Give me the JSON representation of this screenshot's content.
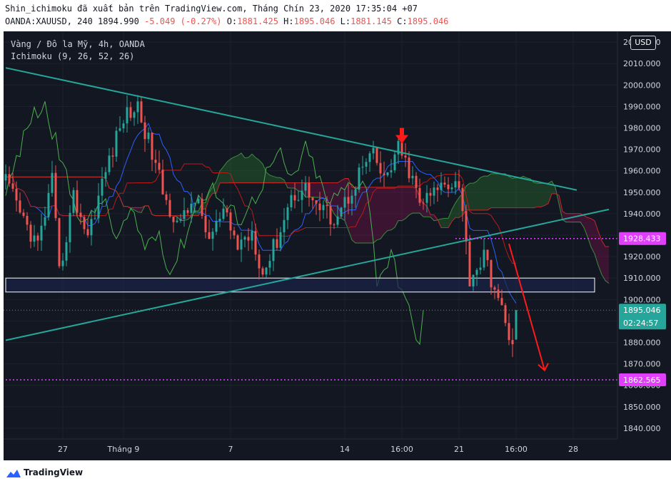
{
  "header": {
    "publish_line": "Shin_ichimoku đã xuất bản trên TradingView.com, Tháng Chín 23, 2020 17:35:04 +07",
    "symbol_prefix": "OANDA:XAUUSD, 240 1894.990",
    "change": "-5.049 (-0.27%)",
    "o_label": "O:",
    "o_value": "1881.425",
    "h_label": "H:",
    "h_value": "1895.046",
    "l_label": "L:",
    "l_value": "1881.145",
    "c_label": "C:",
    "c_value": "1895.046"
  },
  "legend": {
    "instrument": "Vàng / Đô la Mỹ, 4h, OANDA",
    "indicator": "Ichimoku (9, 26, 52, 26)"
  },
  "currency": "USD",
  "footer": {
    "brand": "TradingView"
  },
  "colors": {
    "background": "#131722",
    "up": "#26a69a",
    "down": "#ef5350",
    "trendline": "#26a69a",
    "level": "#e040fb",
    "tenkan": "#2962ff",
    "kijun": "#b71c1c",
    "chikou": "#4caf50",
    "cloud_bull": "#2e7d32",
    "cloud_bear": "#880e4f",
    "grid": "#1e222d",
    "axis_text": "#d1d4dc",
    "arrow": "#ff1a1a"
  },
  "chart_data": {
    "type": "candlestick",
    "symbol": "OANDA:XAUUSD",
    "timeframe": "4h",
    "ylim": [
      1835,
      2025
    ],
    "y_ticks": [
      1840,
      1850,
      1860,
      1870,
      1880,
      1890,
      1900,
      1910,
      1920,
      1930,
      1940,
      1950,
      1960,
      1970,
      1980,
      1990,
      2000,
      2010,
      2020
    ],
    "y_tick_labels": [
      "1840.000",
      "1850.000",
      "1860.000",
      "1870.000",
      "1880.000",
      "1890.000",
      "1900.000",
      "1910.000",
      "1920.000",
      "1930.000",
      "1940.000",
      "1950.000",
      "1960.000",
      "1970.000",
      "1980.000",
      "1990.000",
      "2000.000",
      "2010.000",
      "2020.000"
    ],
    "x_bars": 170,
    "x_ticks": [
      {
        "bar": 16,
        "label": "27"
      },
      {
        "bar": 33,
        "label": "Tháng 9"
      },
      {
        "bar": 63,
        "label": "7"
      },
      {
        "bar": 95,
        "label": "14"
      },
      {
        "bar": 111,
        "label": "16:00"
      },
      {
        "bar": 127,
        "label": "21"
      },
      {
        "bar": 143,
        "label": "16:00"
      },
      {
        "bar": 159,
        "label": "28"
      }
    ],
    "anchors": [
      [
        0,
        1955
      ],
      [
        4,
        1940
      ],
      [
        9,
        1925
      ],
      [
        13,
        1955
      ],
      [
        15,
        1912
      ],
      [
        19,
        1948
      ],
      [
        23,
        1930
      ],
      [
        28,
        1960
      ],
      [
        33,
        1985
      ],
      [
        37,
        1990
      ],
      [
        41,
        1968
      ],
      [
        45,
        1945
      ],
      [
        49,
        1935
      ],
      [
        53,
        1948
      ],
      [
        57,
        1928
      ],
      [
        61,
        1940
      ],
      [
        65,
        1925
      ],
      [
        69,
        1932
      ],
      [
        72,
        1912
      ],
      [
        76,
        1928
      ],
      [
        80,
        1948
      ],
      [
        84,
        1952
      ],
      [
        88,
        1942
      ],
      [
        92,
        1938
      ],
      [
        96,
        1948
      ],
      [
        100,
        1962
      ],
      [
        103,
        1967
      ],
      [
        106,
        1955
      ],
      [
        110,
        1970
      ],
      [
        113,
        1960
      ],
      [
        116,
        1945
      ],
      [
        119,
        1948
      ],
      [
        123,
        1955
      ],
      [
        127,
        1955
      ],
      [
        130,
        1910
      ],
      [
        134,
        1920
      ],
      [
        137,
        1905
      ],
      [
        140,
        1888
      ],
      [
        142,
        1881
      ],
      [
        143,
        1895
      ]
    ],
    "seed": 42,
    "last_price": 1895.046,
    "last_price_label": "1895.046",
    "countdown_label": "02:24:57",
    "levels": [
      {
        "price": 1928.433,
        "label": "1928.433",
        "from_bar": 126
      },
      {
        "price": 1862.565,
        "label": "1862.565",
        "from_bar": 0
      }
    ],
    "zone": {
      "top": 1910,
      "bottom": 1903.5,
      "from_bar": 0,
      "to_bar": 165
    },
    "trendlines": [
      {
        "from": {
          "bar": 0,
          "price": 2008
        },
        "to": {
          "bar": 160,
          "price": 1951
        }
      },
      {
        "from": {
          "bar": 0,
          "price": 1881
        },
        "to": {
          "bar": 169,
          "price": 1942
        }
      }
    ],
    "down_arrow": {
      "from": {
        "bar": 141,
        "price": 1926
      },
      "to": {
        "bar": 151,
        "price": 1867
      }
    },
    "marker_arrow": {
      "bar": 111,
      "price": 1972
    }
  }
}
